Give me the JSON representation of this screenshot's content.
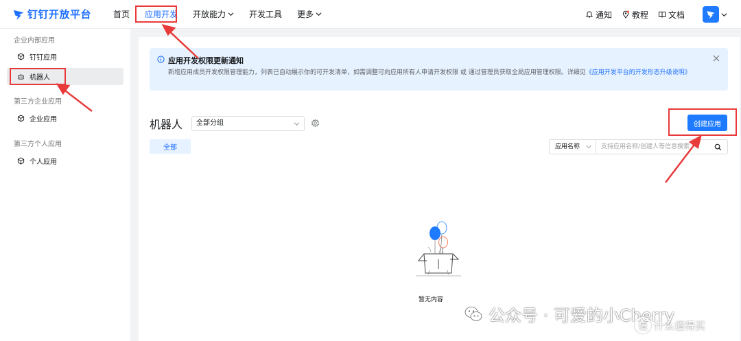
{
  "brand": {
    "name": "钉钉开放平台",
    "color": "#1e6fff"
  },
  "nav": {
    "items": [
      {
        "label": "首页",
        "active": false,
        "dropdown": false
      },
      {
        "label": "应用开发",
        "active": true,
        "dropdown": false
      },
      {
        "label": "开放能力",
        "active": false,
        "dropdown": true
      },
      {
        "label": "开发工具",
        "active": false,
        "dropdown": false
      },
      {
        "label": "更多",
        "active": false,
        "dropdown": true
      }
    ],
    "right": {
      "notify": "通知",
      "tutorial": "教程",
      "docs": "文档"
    }
  },
  "sidebar": {
    "sections": [
      {
        "title": "企业内部应用",
        "items": [
          {
            "label": "钉钉应用"
          },
          {
            "label": "机器人",
            "active": true
          }
        ]
      },
      {
        "title": "第三方企业应用",
        "items": [
          {
            "label": "企业应用"
          }
        ]
      },
      {
        "title": "第三方个人应用",
        "items": [
          {
            "label": "个人应用"
          }
        ]
      }
    ]
  },
  "notice": {
    "title": "应用开发权限更新通知",
    "body": "新增应用成员开发权限管理能力，列表已自动展示你的可开发清单，如需调整可向应用所有人申请开发权限 或 通过管理员获取全局应用管理权限。详细见",
    "link": "《应用开发平台的开发形态升级说明》"
  },
  "main": {
    "title": "机器人",
    "group_select": "全部分组",
    "create_button": "创建应用",
    "tab_all": "全部",
    "search_field": "应用名称",
    "search_placeholder": "支持应用名称/创建人等信息搜索",
    "empty_text": "暂无内容"
  },
  "watermark": {
    "text": "公众号 · 可爱的小Cherry",
    "site": "什么值得买",
    "badge": "值"
  },
  "annotation_color": "#e83a3a"
}
